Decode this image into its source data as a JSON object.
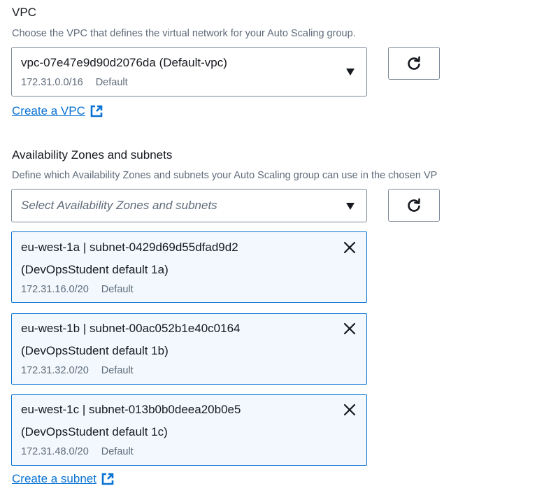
{
  "vpc": {
    "label": "VPC",
    "description": "Choose the VPC that defines the virtual network for your Auto Scaling group.",
    "selected_value": "vpc-07e47e9d90d2076da (Default-vpc)",
    "selected_cidr": "172.31.0.0/16",
    "selected_tag": "Default",
    "create_link": "Create a VPC"
  },
  "subnets": {
    "label": "Availability Zones and subnets",
    "description": "Define which Availability Zones and subnets your Auto Scaling group can use in the chosen VP",
    "placeholder": "Select Availability Zones and subnets",
    "tokens": [
      {
        "line1": "eu-west-1a | subnet-0429d69d55dfad9d2",
        "line2": "(DevOpsStudent default 1a)",
        "cidr": "172.31.16.0/20",
        "tag": "Default"
      },
      {
        "line1": "eu-west-1b | subnet-00ac052b1e40c0164",
        "line2": "(DevOpsStudent default 1b)",
        "cidr": "172.31.32.0/20",
        "tag": "Default"
      },
      {
        "line1": "eu-west-1c | subnet-013b0b0deea20b0e5",
        "line2": "(DevOpsStudent default 1c)",
        "cidr": "172.31.48.0/20",
        "tag": "Default"
      }
    ],
    "create_link": "Create a subnet"
  },
  "icons": {
    "caret": "caret-down-icon",
    "refresh": "refresh-icon",
    "external": "external-link-icon",
    "dismiss": "close-icon"
  },
  "colors": {
    "link": "#0972d3",
    "token_bg": "#f2f8fd",
    "token_border": "#0972d3",
    "text": "#16191f",
    "secondary_text": "#5f6b7a",
    "border": "#7d8998"
  }
}
